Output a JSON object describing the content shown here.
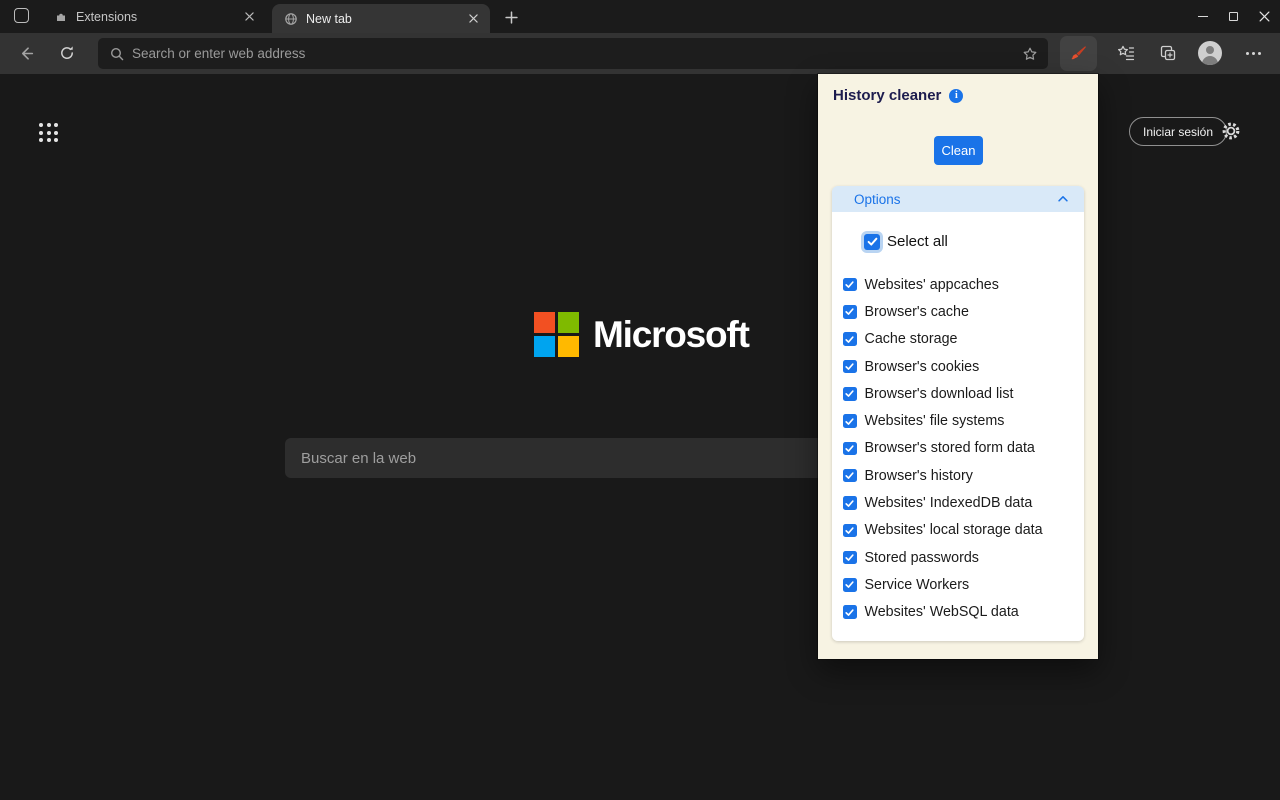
{
  "window": {
    "title_tabs": [
      {
        "label": "Extensions"
      },
      {
        "label": "New tab"
      }
    ]
  },
  "toolbar": {
    "address_placeholder": "Search or enter web address"
  },
  "page": {
    "signin_label": "Iniciar sesión",
    "logo_text": "Microsoft",
    "search_placeholder": "Buscar en la web"
  },
  "popup": {
    "title": "History cleaner",
    "clean_label": "Clean",
    "options_label": "Options",
    "select_all_label": "Select all",
    "items": [
      "Websites' appcaches",
      "Browser's cache",
      "Cache storage",
      "Browser's cookies",
      "Browser's download list",
      "Websites' file systems",
      "Browser's stored form data",
      "Browser's history",
      "Websites' IndexedDB data",
      "Websites' local storage data",
      "Stored passwords",
      "Service Workers",
      "Websites' WebSQL data"
    ]
  },
  "colors": {
    "accent_blue": "#1a73e8",
    "popup_bg": "#f7f3e3",
    "options_header_bg": "#d9e9f8",
    "extension_icon_red": "#e8502f",
    "ms_logo_colors": [
      "#f25022",
      "#7fba00",
      "#00a4ef",
      "#ffb900"
    ]
  }
}
